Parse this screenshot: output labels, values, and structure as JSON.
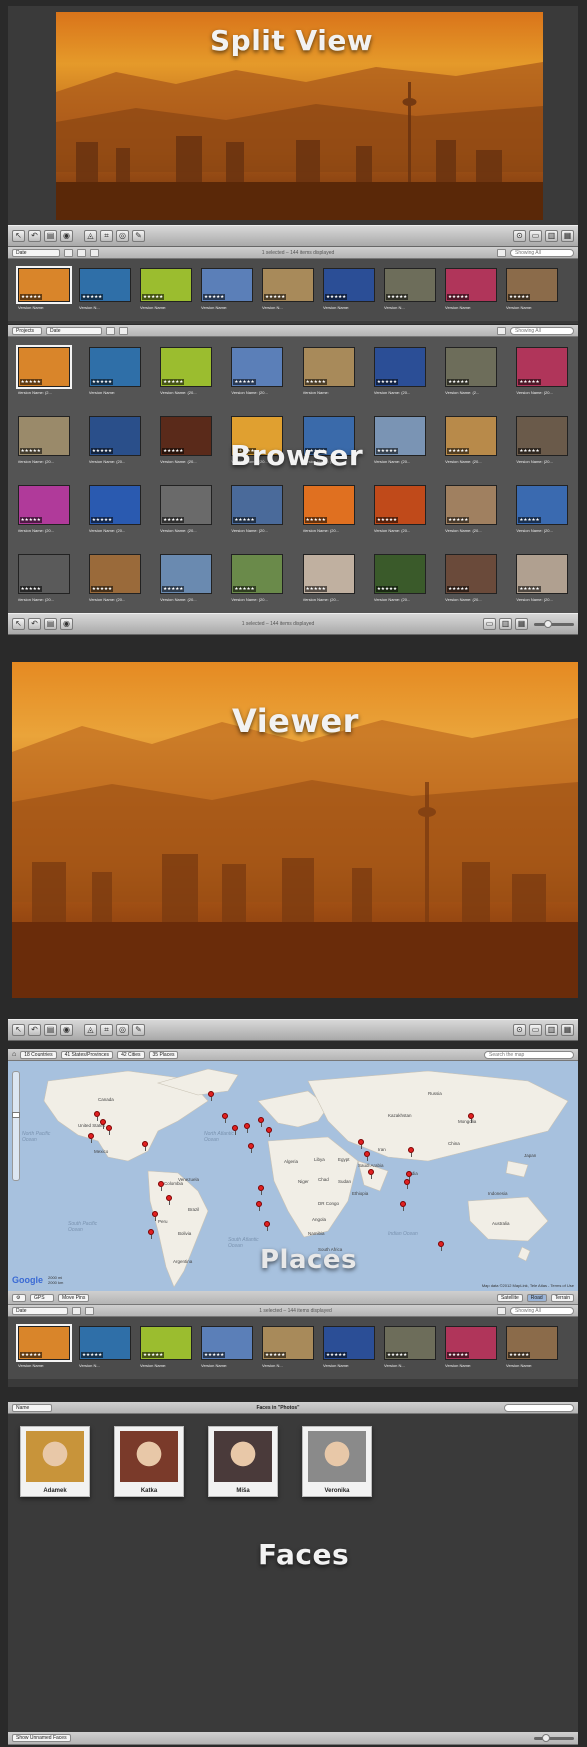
{
  "split_view": {
    "label": "Split View",
    "filter": {
      "sort_popup": "Date",
      "status": "1 selected – 144 items displayed",
      "search_scope": "Showing All"
    },
    "filmstrip": [
      {
        "caption": "Version Name:",
        "stars": "★★★★★",
        "color": "#d9852a"
      },
      {
        "caption": "Version N...",
        "stars": "★★★★★",
        "color": "#2f6fa8"
      },
      {
        "caption": "Version Name:",
        "stars": "★★★★★",
        "color": "#9bbd2f"
      },
      {
        "caption": "Version Name:",
        "stars": "★★★★★",
        "color": "#5b7fb8"
      },
      {
        "caption": "Version N...",
        "stars": "★★★★★",
        "color": "#a88a5a"
      },
      {
        "caption": "Version Name:",
        "stars": "★★★★★",
        "color": "#2b4e96"
      },
      {
        "caption": "Version N...",
        "stars": "★★★★★",
        "color": "#6d6d5a"
      },
      {
        "caption": "Version Name:",
        "stars": "★★★★★",
        "color": "#b0355a"
      },
      {
        "caption": "Version Name:",
        "stars": "★★★★★",
        "color": "#8b6b4a"
      }
    ]
  },
  "browser": {
    "label": "Browser",
    "filter": {
      "projects_popup": "Projects",
      "sort_popup": "Date",
      "search_scope": "Showing All"
    },
    "status": "1 selected – 144 items displayed",
    "rows": [
      [
        {
          "caption": "Version Name: (2...",
          "color": "#d9852a"
        },
        {
          "caption": "Version Name:",
          "color": "#2f6fa8"
        },
        {
          "caption": "Version Name: (20...",
          "color": "#9bbd2f"
        },
        {
          "caption": "Version Name: (20...",
          "color": "#5b7fb8"
        },
        {
          "caption": "Version Name:",
          "color": "#a88a5a"
        },
        {
          "caption": "Version Name: (20...",
          "color": "#2b4e96"
        },
        {
          "caption": "Version Name: (2...",
          "color": "#6d6d5a"
        },
        {
          "caption": "Version Name: (20...",
          "color": "#b0355a"
        }
      ],
      [
        {
          "caption": "Version Name: (20...",
          "color": "#9a8a6a"
        },
        {
          "caption": "Version Name: (20...",
          "color": "#2a4f8a"
        },
        {
          "caption": "Version Name: (20...",
          "color": "#5a2a1a"
        },
        {
          "caption": "Version Name: (20...",
          "color": "#e0a030"
        },
        {
          "caption": "Version Name: (20...",
          "color": "#3a6aaa"
        },
        {
          "caption": "Version Name: (20...",
          "color": "#7a94b4"
        },
        {
          "caption": "Version Name: (20...",
          "color": "#b88a4a"
        },
        {
          "caption": "Version Name: (20...",
          "color": "#6a5a4a"
        }
      ],
      [
        {
          "caption": "Version Name: (20...",
          "color": "#b03a9a"
        },
        {
          "caption": "Version Name: (20...",
          "color": "#2a5ab0"
        },
        {
          "caption": "Version Name: (20...",
          "color": "#6a6a6a"
        },
        {
          "caption": "Version Name: (20...",
          "color": "#4a6a9a"
        },
        {
          "caption": "Version Name: (20...",
          "color": "#e07020"
        },
        {
          "caption": "Version Name: (20...",
          "color": "#c04a1a"
        },
        {
          "caption": "Version Name: (20...",
          "color": "#a08060"
        },
        {
          "caption": "Version Name: (20...",
          "color": "#3a6ab0"
        }
      ],
      [
        {
          "caption": "Version Name: (20...",
          "color": "#5a5a5a"
        },
        {
          "caption": "Version Name: (20...",
          "color": "#9a6a3a"
        },
        {
          "caption": "Version Name: (20...",
          "color": "#6a8ab0"
        },
        {
          "caption": "Version Name: (20...",
          "color": "#6a8a4a"
        },
        {
          "caption": "Version Name: (20...",
          "color": "#c0b0a0"
        },
        {
          "caption": "Version Name: (20...",
          "color": "#3a5a2a"
        },
        {
          "caption": "Version Name: (20...",
          "color": "#6a4a3a"
        },
        {
          "caption": "Version Name: (20...",
          "color": "#b0a090"
        }
      ]
    ]
  },
  "viewer": {
    "label": "Viewer"
  },
  "places": {
    "label": "Places",
    "filter": {
      "countries": "18 Countries",
      "states": "41 States/Provinces",
      "cities": "42 Cities",
      "places": "35 Places",
      "search_placeholder": "Search the map"
    },
    "map_labels": {
      "countries": [
        "United States",
        "Canada",
        "Mexico",
        "Brazil",
        "Peru",
        "Bolivia",
        "Argentina",
        "Colombia",
        "Venezuela",
        "Russia",
        "China",
        "India",
        "Mongolia",
        "Kazakhstan",
        "Algeria",
        "Libya",
        "Egypt",
        "Niger",
        "Chad",
        "Sudan",
        "Ethiopia",
        "DR Congo",
        "Angola",
        "Namibia",
        "South Africa",
        "Australia",
        "Indonesia",
        "Iran",
        "Saudi Arabia",
        "Japan"
      ],
      "oceans": [
        "North Pacific Ocean",
        "North Atlantic Ocean",
        "South Pacific Ocean",
        "South Atlantic Ocean",
        "Indian Ocean"
      ]
    },
    "attribution": "Map data ©2012 MapLink, Tele Atlas - Terms of Use",
    "scale": [
      "2000 mi",
      "2000 km"
    ],
    "google": "Google",
    "controls": {
      "gps": "GPS",
      "move_pins": "Move Pins",
      "satellite": "Satellite",
      "road": "Road",
      "terrain": "Terrain"
    },
    "strip_filter": {
      "sort_popup": "Date",
      "status": "1 selected – 144 items displayed",
      "search_scope": "Showing All"
    }
  },
  "faces": {
    "label": "Faces",
    "sort_popup": "Name",
    "title": "Faces in \"Photos\"",
    "people": [
      {
        "name": "Adamek",
        "color": "#c8943a"
      },
      {
        "name": "Katka",
        "color": "#7a3a2a"
      },
      {
        "name": "Miša",
        "color": "#4a3a3a"
      },
      {
        "name": "Veronika",
        "color": "#8a8a8a"
      }
    ],
    "show_unnamed": "Show Unnamed Faces"
  },
  "colors": {
    "sky_top": "#e08a1e",
    "sky_bottom": "#5a2a08",
    "chrome": "#b9b9b9",
    "map_water": "#a7c1de",
    "map_land": "#f1eee6"
  }
}
